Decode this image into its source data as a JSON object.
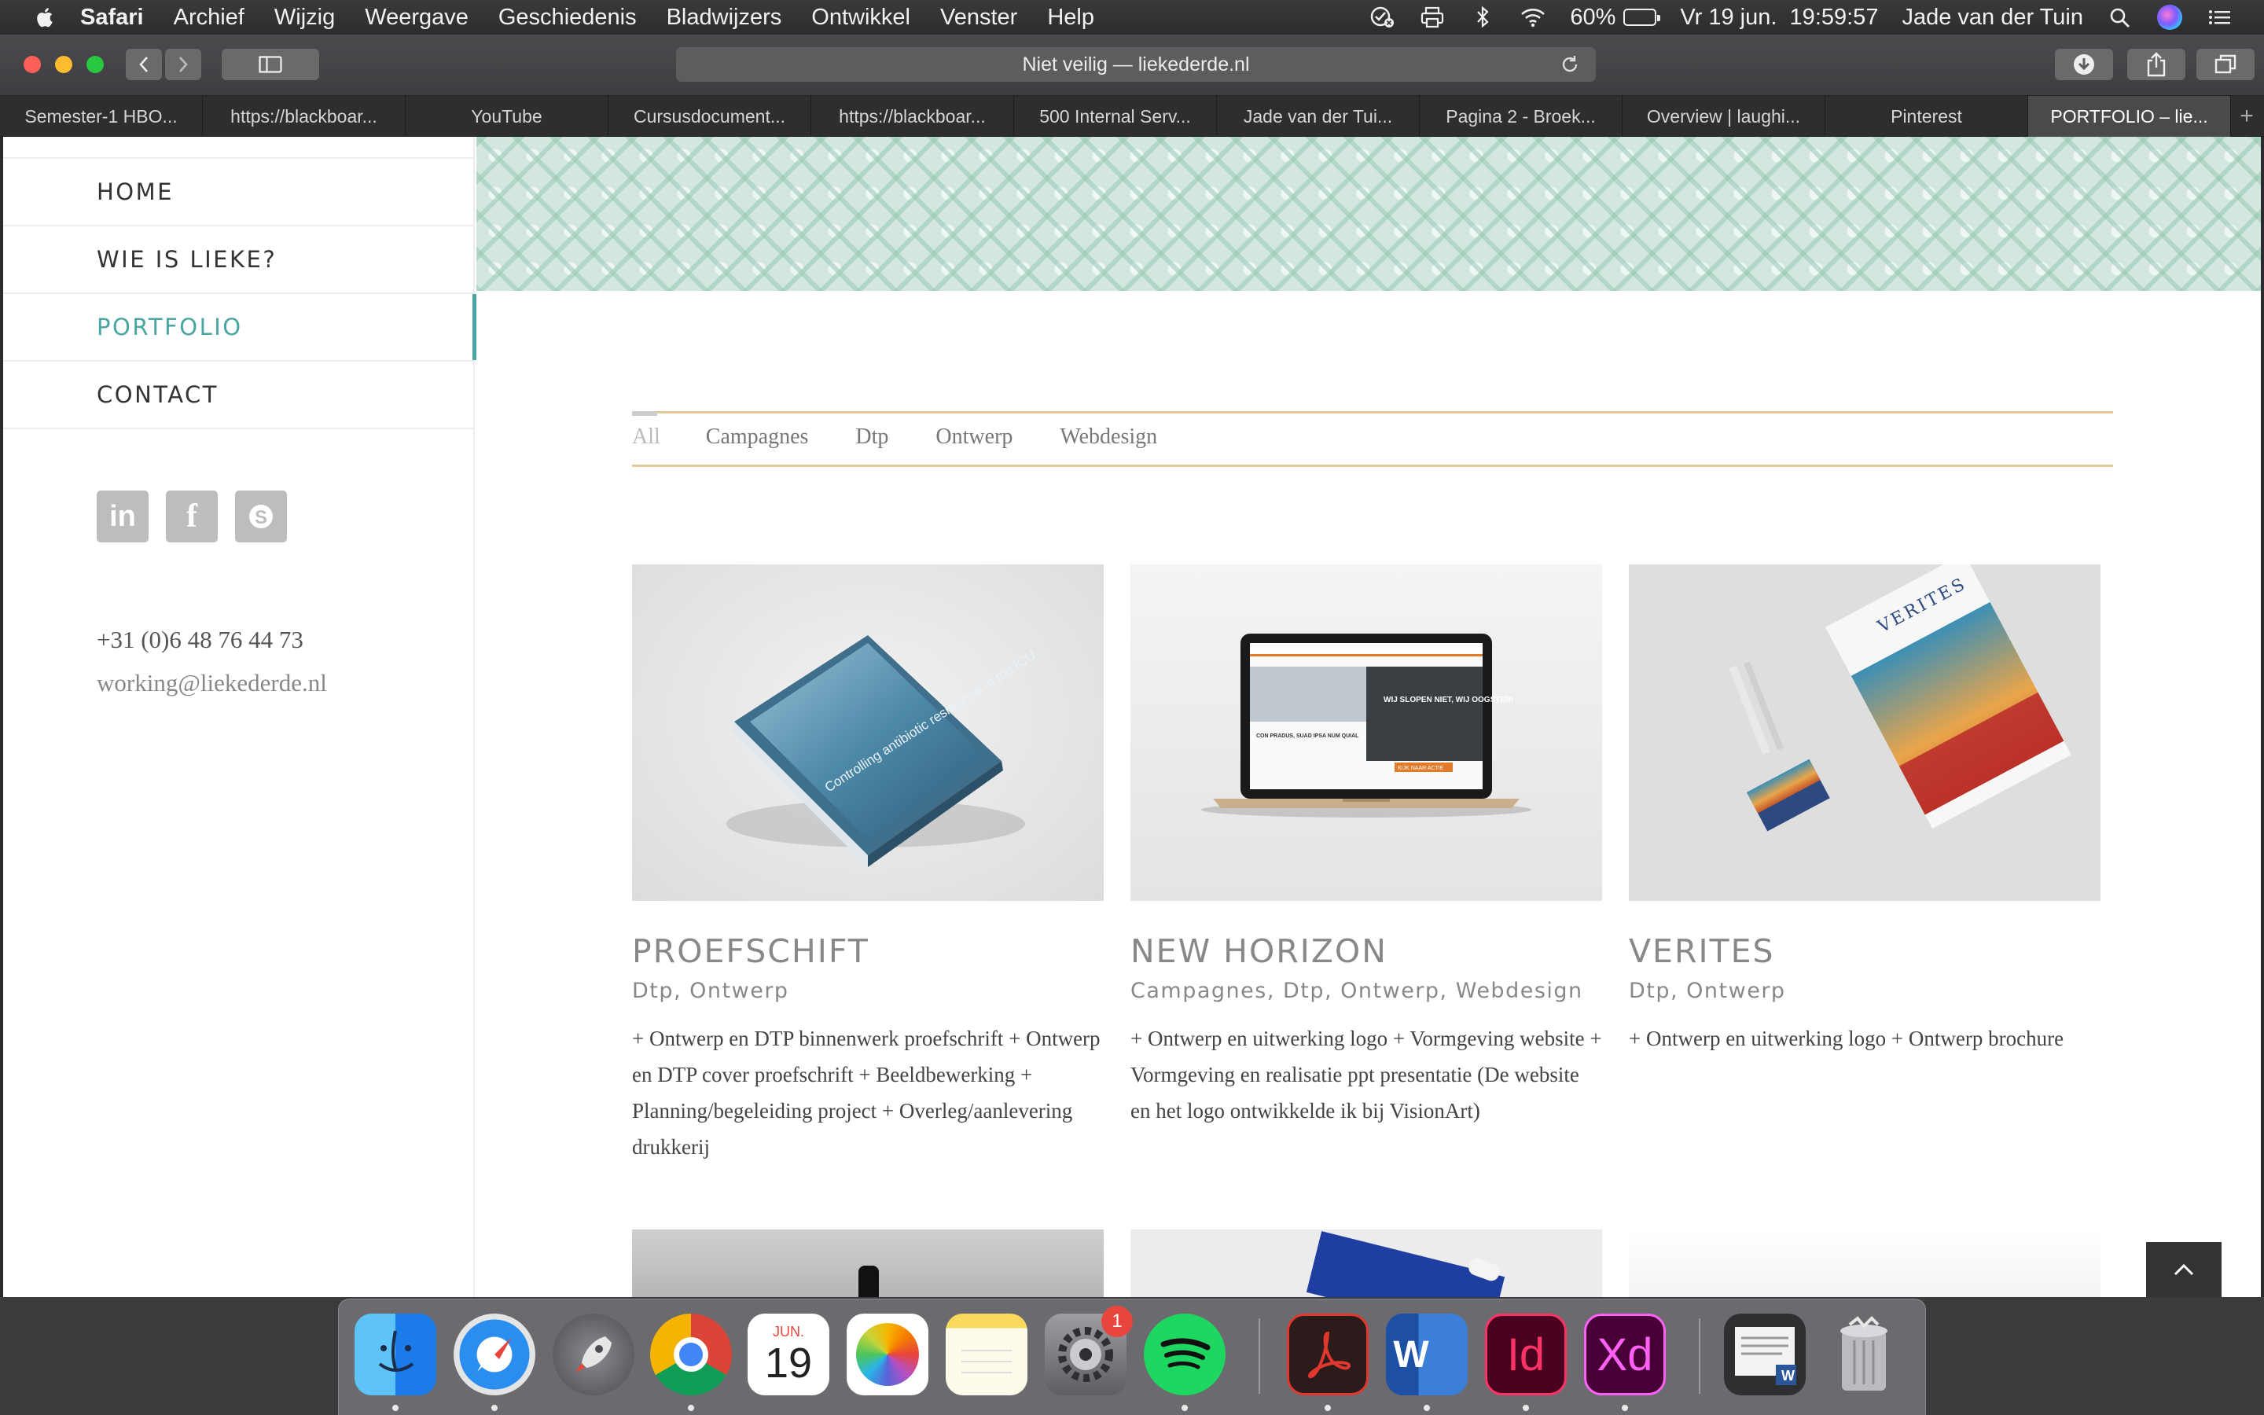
{
  "menubar": {
    "app": "Safari",
    "items": [
      "Archief",
      "Wijzig",
      "Weergave",
      "Geschiedenis",
      "Bladwijzers",
      "Ontwikkel",
      "Venster",
      "Help"
    ],
    "battery_percent": "60%",
    "battery_level": 0.6,
    "datetime": "Vr 19 jun.  19:59:57",
    "user": "Jade van der Tuin"
  },
  "toolbar": {
    "address": "Niet veilig — liekederde.nl"
  },
  "tabs": [
    {
      "label": "Semester-1 HBO..."
    },
    {
      "label": "https://blackboar..."
    },
    {
      "label": "YouTube"
    },
    {
      "label": "Cursusdocument..."
    },
    {
      "label": "https://blackboar..."
    },
    {
      "label": "500 Internal Serv..."
    },
    {
      "label": "Jade van der Tui..."
    },
    {
      "label": "Pagina 2 - Broek..."
    },
    {
      "label": "Overview | laughi..."
    },
    {
      "label": "Pinterest"
    },
    {
      "label": "PORTFOLIO – lie..."
    }
  ],
  "sidebar": {
    "nav": [
      {
        "label": "HOME"
      },
      {
        "label": "WIE IS LIEKE?"
      },
      {
        "label": "PORTFOLIO"
      },
      {
        "label": "CONTACT"
      }
    ],
    "socials": [
      {
        "icon": "linkedin-icon",
        "glyph": "in"
      },
      {
        "icon": "facebook-icon",
        "glyph": "f"
      },
      {
        "icon": "skype-icon",
        "glyph": "S"
      }
    ],
    "phone": "+31 (0)6 48 76 44 73",
    "email": "working@liekederde.nl"
  },
  "filters": [
    "All",
    "Campagnes",
    "Dtp",
    "Ontwerp",
    "Webdesign"
  ],
  "projects": [
    {
      "title": "PROEFSCHIFT",
      "categories": "Dtp, Ontwerp",
      "description": "+ Ontwerp en DTP binnenwerk proefschrift + Ontwerp en DTP cover proefschrift + Beeldbewerking + Planning/begeleiding project + Overleg/aanlevering drukkerij",
      "book_text": "Controlling antibiotic resistance in the ICU"
    },
    {
      "title": "NEW HORIZON",
      "categories": "Campagnes, Dtp, Ontwerp, Webdesign",
      "description": "+ Ontwerp en uitwerking logo + Vormgeving website + Vormgeving en realisatie ppt presentatie (De website en het logo ontwikkelde ik bij VisionArt)",
      "screen_headline": "WIJ SLOPEN NIET, WIJ OOGSTEN!",
      "screen_sub": "CON PRADUS, SUAD IPSA NUM QUIAL",
      "screen_button": "KIJK NAAR ACTIE"
    },
    {
      "title": "VERITES",
      "categories": "Dtp, Ontwerp",
      "description": "+  Ontwerp en uitwerking logo +  Ontwerp brochure",
      "brand": "VERITES"
    }
  ],
  "dock": {
    "calendar_month": "JUN.",
    "calendar_day": "19",
    "settings_badge": "1",
    "word_letter": "W",
    "indesign_label": "Id",
    "xd_label": "Xd"
  }
}
